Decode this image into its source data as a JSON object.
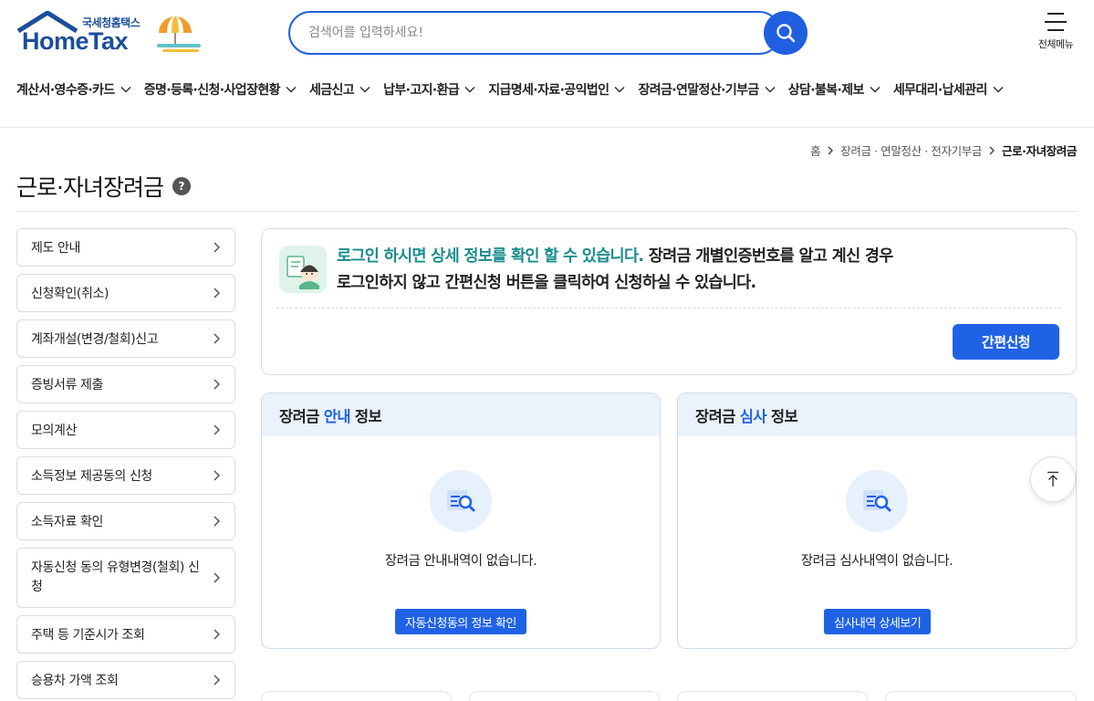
{
  "header": {
    "logo_sub": "국세청홈택스",
    "logo_main": "HomeTax",
    "search_placeholder": "검색어를 입력하세요!",
    "all_menu_label": "전체메뉴"
  },
  "gnb": [
    {
      "label": "계산서·영수증·카드"
    },
    {
      "label": "증명·등록·신청·사업장현황"
    },
    {
      "label": "세금신고"
    },
    {
      "label": "납부·고지·환급"
    },
    {
      "label": "지급명세·자료·공익법인"
    },
    {
      "label": "장려금·연말정산·기부금"
    },
    {
      "label": "상담·불복·제보"
    },
    {
      "label": "세무대리·납세관리"
    }
  ],
  "breadcrumb": {
    "home": "홈",
    "parent": "장려금 · 연말정산 · 전자기부금",
    "current": "근로·자녀장려금"
  },
  "page": {
    "title": "근로·자녀장려금",
    "help_glyph": "?"
  },
  "side_menu": [
    {
      "label": "제도 안내"
    },
    {
      "label": "신청확인(취소)"
    },
    {
      "label": "계좌개설(변경/철회)신고"
    },
    {
      "label": "증빙서류 제출"
    },
    {
      "label": "모의계산"
    },
    {
      "label": "소득정보 제공동의 신청"
    },
    {
      "label": "소득자료 확인"
    },
    {
      "label": "자동신청 동의 유형변경(철회) 신청"
    },
    {
      "label": "주택 등 기준시가 조회"
    },
    {
      "label": "승용차 가액 조회"
    }
  ],
  "notice": {
    "accent_text": "로그인 하시면 상세 정보를 확인 할 수 있습니다.",
    "text_line1_rest": " 장려금 개별인증번호를 알고 계신 경우",
    "text_line2": "로그인하지 않고 간편신청 버튼을 클릭하여 신청하실 수 있습니다.",
    "button_label": "간편신청"
  },
  "cards": {
    "guide": {
      "title_prefix": "장려금",
      "title_accent": "안내",
      "title_suffix": "정보",
      "empty_text": "장려금 안내내역이 없습니다.",
      "button_label": "자동신청동의 정보 확인"
    },
    "review": {
      "title_prefix": "장려금",
      "title_accent": "심사",
      "title_suffix": "정보",
      "empty_text": "장려금 심사내역이 없습니다.",
      "button_label": "심사내역 상세보기"
    }
  },
  "colors": {
    "brand_blue": "#1f62e6",
    "notice_accent": "#1a8c8c",
    "card_head_bg": "#ebf2fc"
  },
  "icons": {
    "search": "search-icon",
    "menu": "hamburger-icon",
    "chevron": "chevron-down-icon",
    "side_chevron": "chevron-right-icon",
    "help": "help-icon",
    "scroll_top": "arrow-up-icon",
    "empty": "document-search-icon"
  }
}
